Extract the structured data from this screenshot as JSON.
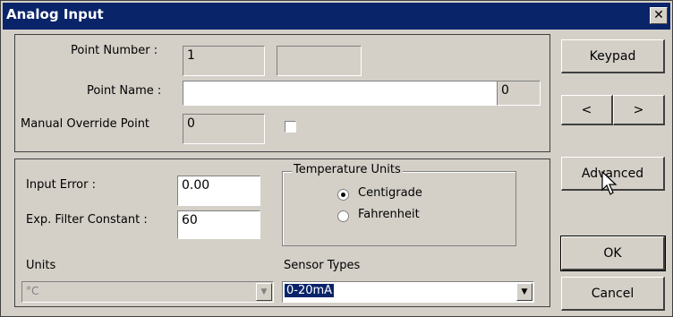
{
  "window": {
    "title": "Analog Input",
    "close_label": "✕"
  },
  "point": {
    "number_label": "Point Number :",
    "number_value": "1",
    "number_extra": "",
    "name_label": "Point Name :",
    "name_value": "",
    "name_length": "0",
    "override_label": "Manual Override Point",
    "override_value": "0"
  },
  "settings": {
    "input_error_label": "Input Error :",
    "input_error_value": "0.00",
    "filter_label": "Exp. Filter Constant :",
    "filter_value": "60",
    "temp_units_legend": "Temperature Units",
    "centigrade_label": "Centigrade",
    "fahrenheit_label": "Fahrenheit",
    "selected_temp_unit": "Centigrade",
    "units_label": "Units",
    "units_value": "°C",
    "sensor_label": "Sensor Types",
    "sensor_value": "0-20mA"
  },
  "buttons": {
    "keypad": "Keypad",
    "prev": "<",
    "next": ">",
    "advanced": "Advanced",
    "ok": "OK",
    "cancel": "Cancel"
  }
}
